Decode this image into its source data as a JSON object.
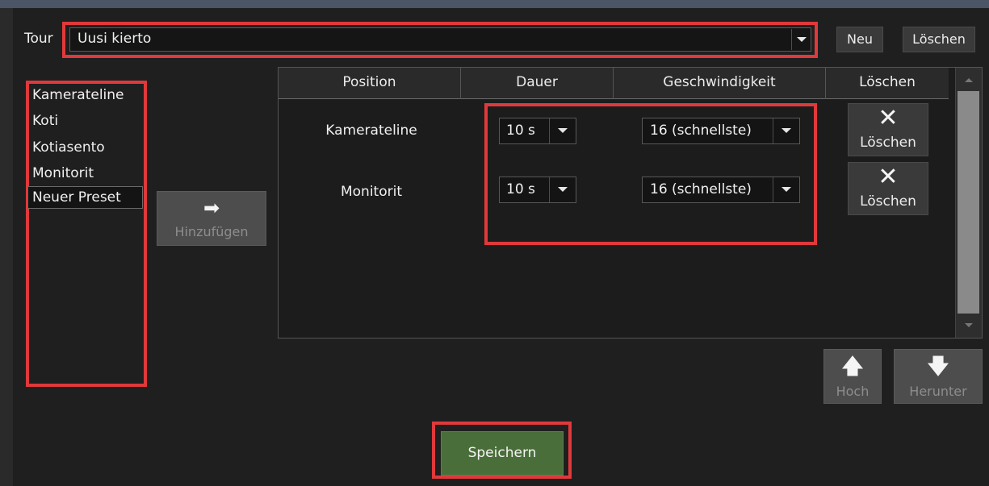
{
  "tour": {
    "label": "Tour",
    "selected": "Uusi kierto",
    "new_label": "Neu",
    "delete_label": "Löschen"
  },
  "presets": {
    "items": [
      {
        "label": "Kamerateline"
      },
      {
        "label": "Koti"
      },
      {
        "label": "Kotiasento"
      },
      {
        "label": "Monitorit"
      },
      {
        "label": "Neuer Preset"
      }
    ],
    "selected_index": 4
  },
  "add_button": {
    "label": "Hinzufügen",
    "icon": "arrow-right-icon"
  },
  "table": {
    "headers": [
      "Position",
      "Dauer",
      "Geschwindigkeit",
      "Löschen"
    ],
    "rows": [
      {
        "position": "Kamerateline",
        "duration": "10 s",
        "speed": "16 (schnellste)",
        "delete_label": "Löschen"
      },
      {
        "position": "Monitorit",
        "duration": "10 s",
        "speed": "16 (schnellste)",
        "delete_label": "Löschen"
      }
    ]
  },
  "move": {
    "up_label": "Hoch",
    "down_label": "Herunter"
  },
  "save_label": "Speichern",
  "colors": {
    "highlight": "#e0393b",
    "save_button": "#4a6e3a",
    "panel_bg": "#1f1f1f"
  }
}
